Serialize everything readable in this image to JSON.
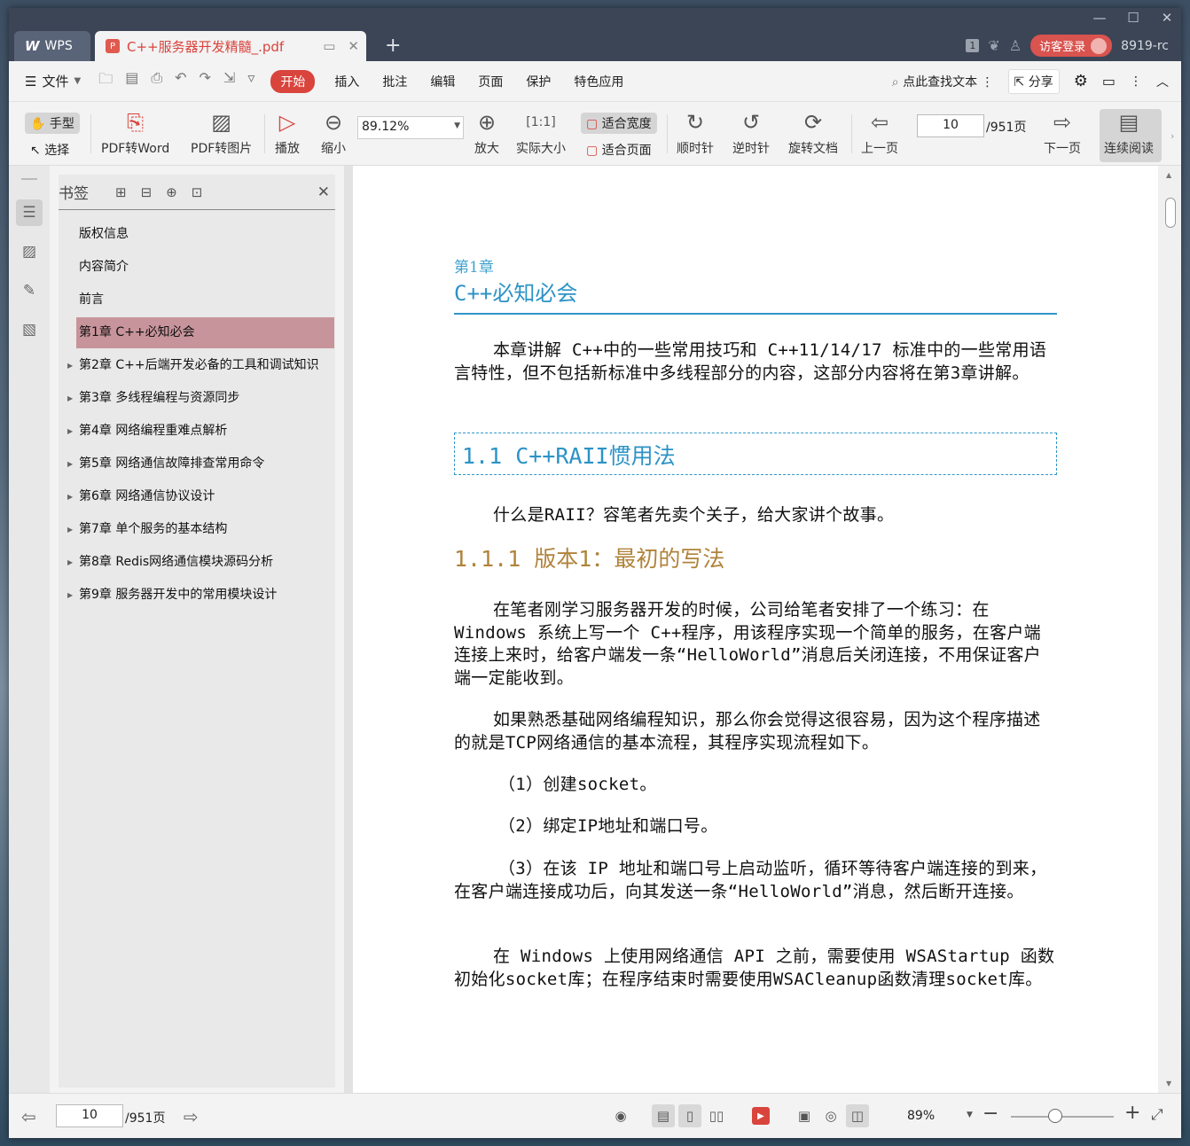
{
  "window_controls": {
    "min": "—",
    "max": "☐",
    "close": "✕"
  },
  "tabs": {
    "wps_label": "WPS",
    "wps_logo": "W",
    "doc_title": "C++服务器开发精髓_.pdf",
    "doc_icon": "pdf-icon"
  },
  "title_right": {
    "badge": "1",
    "login": "访客登录",
    "user": "8919-rc"
  },
  "menubar": {
    "file": "文件",
    "menus": [
      "开始",
      "插入",
      "批注",
      "编辑",
      "页面",
      "保护",
      "特色应用"
    ],
    "search": "点此查找文本",
    "share": "分享"
  },
  "toolbar": {
    "hand": "手型",
    "select": "选择",
    "pdf_to_word": "PDF转Word",
    "pdf_to_image": "PDF转图片",
    "play": "播放",
    "zoom_out": "缩小",
    "zoom_value": "89.12%",
    "zoom_in": "放大",
    "actual_size": "实际大小",
    "fit_width": "适合宽度",
    "fit_page": "适合页面",
    "rotate_cw": "顺时针",
    "rotate_ccw": "逆时针",
    "rotate_doc": "旋转文档",
    "prev_page": "上一页",
    "page_current": "10",
    "page_total": "/951页",
    "next_page": "下一页",
    "continuous": "连续阅读"
  },
  "bookmarks": {
    "title": "书签",
    "items": [
      {
        "label": "版权信息",
        "expandable": false
      },
      {
        "label": "内容简介",
        "expandable": false
      },
      {
        "label": "前言",
        "expandable": false
      },
      {
        "label": "第1章 C++必知必会",
        "expandable": true,
        "selected": true
      },
      {
        "label": "第2章 C++后端开发必备的工具和调试知识",
        "expandable": true
      },
      {
        "label": "第3章 多线程编程与资源同步",
        "expandable": true
      },
      {
        "label": "第4章 网络编程重难点解析",
        "expandable": true
      },
      {
        "label": "第5章 网络通信故障排查常用命令",
        "expandable": true
      },
      {
        "label": "第6章 网络通信协议设计",
        "expandable": true
      },
      {
        "label": "第7章 单个服务的基本结构",
        "expandable": true
      },
      {
        "label": "第8章 Redis网络通信模块源码分析",
        "expandable": true
      },
      {
        "label": "第9章 服务器开发中的常用模块设计",
        "expandable": true
      }
    ]
  },
  "page": {
    "chapter_no": "第1章",
    "chapter_title": "C++必知必会",
    "intro": "本章讲解 C++中的一些常用技巧和 C++11/14/17 标准中的一些常用语言特性，但不包括新标准中多线程部分的内容，这部分内容将在第3章讲解。",
    "section_title": "1.1 C++RAII惯用法",
    "p_raii": "什么是RAII？容笔者先卖个关子，给大家讲个故事。",
    "subsection_title": "1.1.1 版本1：最初的写法",
    "p1": "在笔者刚学习服务器开发的时候，公司给笔者安排了一个练习：在 Windows 系统上写一个 C++程序，用该程序实现一个简单的服务，在客户端连接上来时，给客户端发一条“HelloWorld”消息后关闭连接，不用保证客户端一定能收到。",
    "p2": "如果熟悉基础网络编程知识，那么你会觉得这很容易，因为这个程序描述的就是TCP网络通信的基本流程，其程序实现流程如下。",
    "step1": "（1）创建socket。",
    "step2": "（2）绑定IP地址和端口号。",
    "step3": "（3）在该 IP 地址和端口号上启动监听，循环等待客户端连接的到来，在客户端连接成功后，向其发送一条“HelloWorld”消息，然后断开连接。",
    "p3": "在 Windows 上使用网络通信 API 之前，需要使用 WSAStartup 函数初始化socket库；在程序结束时需要使用WSACleanup函数清理socket库。"
  },
  "statusbar": {
    "page_current": "10",
    "page_total": "/951页",
    "zoom": "89%"
  },
  "colors": {
    "accent": "#d9443d",
    "heading_blue": "#2c93c6",
    "subheading_brown": "#b0833a",
    "bookmark_selected": "#c8949b"
  }
}
